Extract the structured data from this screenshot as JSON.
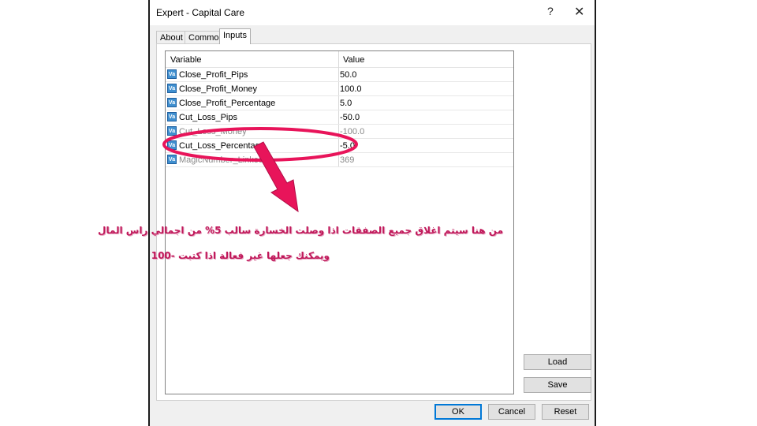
{
  "window": {
    "title": "Expert - Capital Care",
    "help_glyph": "?",
    "close_glyph": "✕"
  },
  "tabs": [
    {
      "label": "About"
    },
    {
      "label": "Common"
    },
    {
      "label": "Inputs"
    }
  ],
  "grid": {
    "headers": {
      "variable": "Variable",
      "value": "Value"
    },
    "icon_text": "Va",
    "rows": [
      {
        "name": "Close_Profit_Pips",
        "value": "50.0"
      },
      {
        "name": "Close_Profit_Money",
        "value": "100.0"
      },
      {
        "name": "Close_Profit_Percentage",
        "value": "5.0"
      },
      {
        "name": "Cut_Loss_Pips",
        "value": "-50.0"
      },
      {
        "name": "Cut_Loss_Money",
        "value": "-100.0"
      },
      {
        "name": "Cut_Loss_Percentage",
        "value": "-5.0"
      },
      {
        "name": "MagicNumber_LinkedI",
        "value": "369"
      }
    ]
  },
  "side_buttons": {
    "load": "Load",
    "save": "Save"
  },
  "bottom_buttons": {
    "ok": "OK",
    "cancel": "Cancel",
    "reset": "Reset"
  },
  "annotation": {
    "line1": "من هنا سيتم اغلاق جميع الصفقات اذا وصلت الخسارة سالب 5% من اجمالي راس المال",
    "line2": "ويمكنك جعلها غير فعالة اذا كتبت -100",
    "color": "#e8145a"
  }
}
